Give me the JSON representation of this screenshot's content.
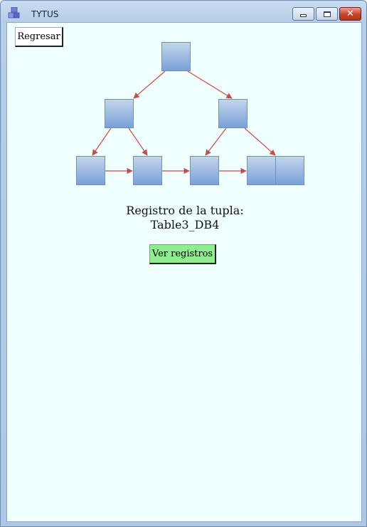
{
  "window": {
    "title": "TYTUS",
    "icon": "app-cubes-icon",
    "controls": [
      "minimize-icon",
      "maximize-icon",
      "close-icon"
    ],
    "close_glyph": "✕"
  },
  "toolbar": {
    "back_label": "Regresar"
  },
  "tree": {
    "node_color": "#8fb0e0",
    "edge_color": "#c0504d",
    "levels": [
      1,
      2,
      5
    ]
  },
  "caption": {
    "line1": "Registro de la tupla:",
    "line2": "Table3_DB4"
  },
  "actions": {
    "view_label": "Ver registros",
    "view_color": "#90ee90"
  }
}
